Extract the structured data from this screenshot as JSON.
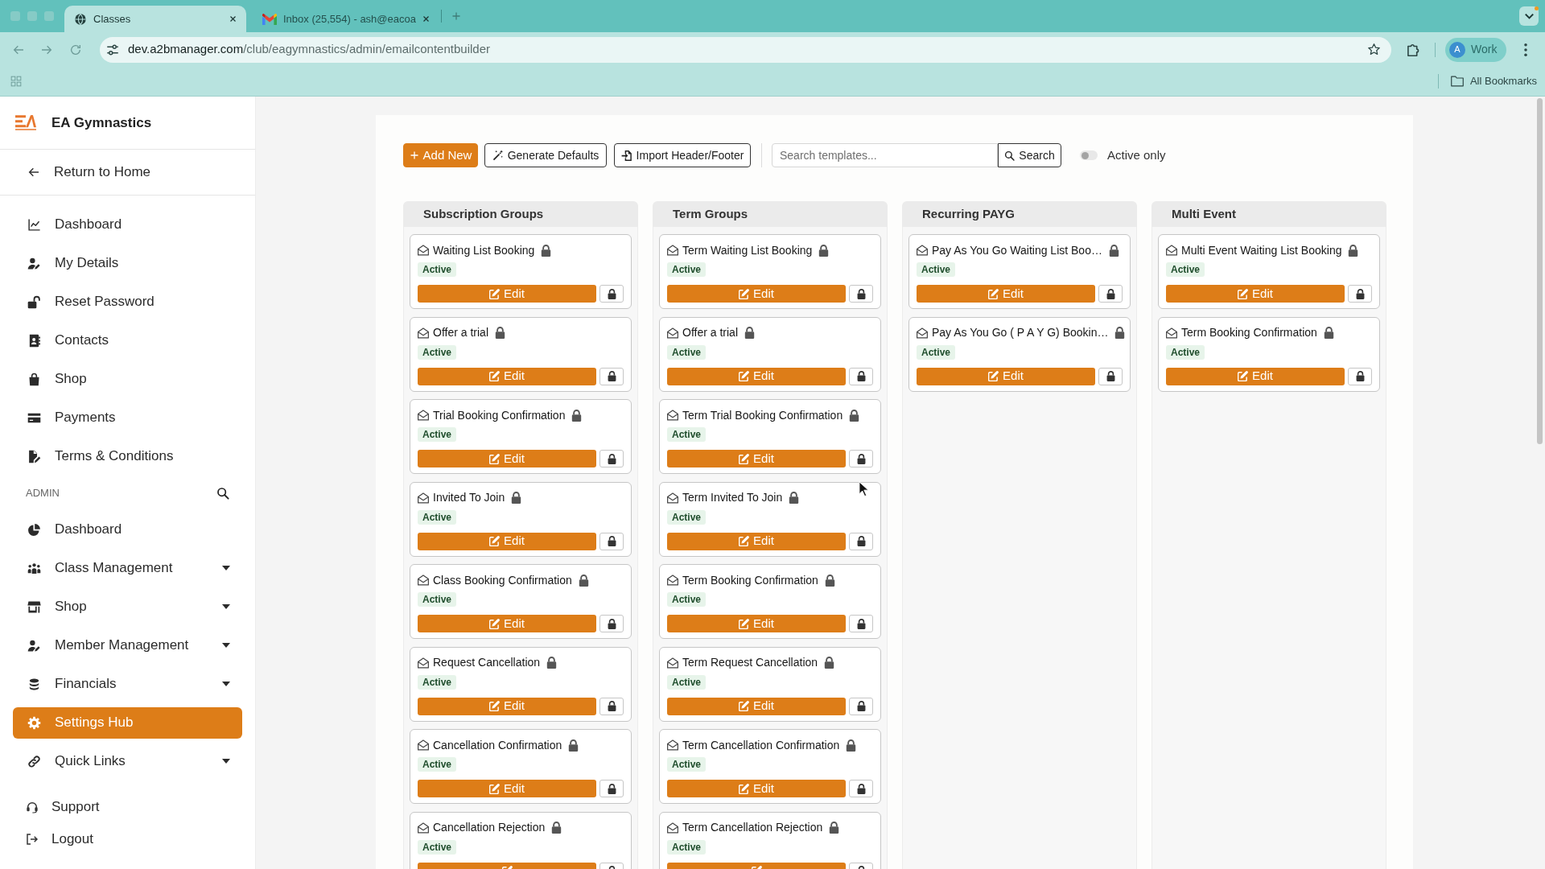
{
  "browser": {
    "tabs": [
      {
        "title": "Classes",
        "selected": true
      },
      {
        "title": "Inbox (25,554) - ash@eacoa",
        "selected": false
      }
    ],
    "url": "dev.a2bmanager.com/club/eagymnastics/admin/emailcontentbuilder",
    "profile": {
      "initial": "A",
      "label": "Work"
    },
    "bookmarks": "All Bookmarks"
  },
  "sidebar": {
    "brand": "EA Gymnastics",
    "back_link": "Return to Home",
    "menu": [
      {
        "label": "Dashboard",
        "selected": false
      },
      {
        "label": "My Details",
        "selected": false
      },
      {
        "label": "Reset Password",
        "selected": false
      },
      {
        "label": "Contacts",
        "selected": false
      },
      {
        "label": "Shop",
        "selected": false
      },
      {
        "label": "Payments",
        "selected": false
      },
      {
        "label": "Terms & Conditions",
        "selected": false
      }
    ],
    "admin": {
      "heading": "ADMIN",
      "items": [
        {
          "label": "Dashboard",
          "selected": false,
          "submenu": false
        },
        {
          "label": "Class Management",
          "selected": false,
          "submenu": true
        },
        {
          "label": "Shop",
          "selected": false,
          "submenu": true
        },
        {
          "label": "Member Management",
          "selected": false,
          "submenu": true
        },
        {
          "label": "Financials",
          "selected": false,
          "submenu": true
        },
        {
          "label": "Settings Hub",
          "selected": true,
          "submenu": false
        },
        {
          "label": "Quick Links",
          "selected": false,
          "submenu": true
        }
      ]
    },
    "footer": [
      {
        "label": "Support"
      },
      {
        "label": "Logout"
      }
    ]
  },
  "toolbar": {
    "buttons": [
      {
        "label": "Add New",
        "kind": "primary"
      },
      {
        "label": "Generate Defaults",
        "kind": "outline"
      },
      {
        "label": "Import Header/Footer",
        "kind": "outline"
      }
    ],
    "search": {
      "placeholder": "Search templates...",
      "button": "Search"
    },
    "active_only": {
      "label": "Active only",
      "on": false
    }
  },
  "columns": [
    {
      "title": "Subscription Groups",
      "templates": [
        {
          "name": "Waiting List Booking",
          "locked": true,
          "status": "Active",
          "action": "Edit"
        },
        {
          "name": "Offer a trial",
          "locked": true,
          "status": "Active",
          "action": "Edit"
        },
        {
          "name": "Trial Booking Confirmation",
          "locked": true,
          "status": "Active",
          "action": "Edit"
        },
        {
          "name": "Invited To Join",
          "locked": true,
          "status": "Active",
          "action": "Edit"
        },
        {
          "name": "Class Booking Confirmation",
          "locked": true,
          "status": "Active",
          "action": "Edit"
        },
        {
          "name": "Request Cancellation",
          "locked": true,
          "status": "Active",
          "action": "Edit"
        },
        {
          "name": "Cancellation Confirmation",
          "locked": true,
          "status": "Active",
          "action": "Edit"
        },
        {
          "name": "Cancellation Rejection",
          "locked": true,
          "status": "Active"
        }
      ]
    },
    {
      "title": "Term Groups",
      "templates": [
        {
          "name": "Term Waiting List Booking",
          "locked": true,
          "status": "Active",
          "action": "Edit"
        },
        {
          "name": "Offer a trial",
          "locked": true,
          "status": "Active",
          "action": "Edit"
        },
        {
          "name": "Term Trial Booking Confirmation",
          "locked": true,
          "status": "Active",
          "action": "Edit"
        },
        {
          "name": "Term Invited To Join",
          "locked": true,
          "status": "Active",
          "action": "Edit"
        },
        {
          "name": "Term Booking Confirmation",
          "locked": true,
          "status": "Active",
          "action": "Edit"
        },
        {
          "name": "Term Request Cancellation",
          "locked": true,
          "status": "Active",
          "action": "Edit"
        },
        {
          "name": "Term Cancellation Confirmation",
          "locked": true,
          "status": "Active",
          "action": "Edit"
        },
        {
          "name": "Term Cancellation Rejection",
          "locked": true,
          "status": "Active"
        }
      ]
    },
    {
      "title": "Recurring PAYG",
      "templates": [
        {
          "name": "Pay As You Go Waiting List Boo…",
          "locked": true,
          "status": "Active",
          "action": "Edit"
        },
        {
          "name": "Pay As You Go ( P A Y G) Bookin…",
          "locked": true,
          "status": "Active",
          "action": "Edit"
        }
      ]
    },
    {
      "title": "Multi Event",
      "templates": [
        {
          "name": "Multi Event Waiting List Booking",
          "locked": true,
          "status": "Active",
          "action": "Edit"
        },
        {
          "name": "Term Booking Confirmation",
          "locked": true,
          "status": "Active",
          "action": "Edit"
        }
      ]
    }
  ]
}
